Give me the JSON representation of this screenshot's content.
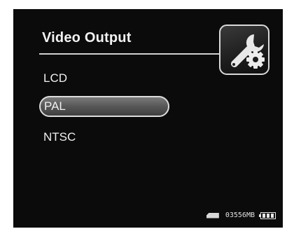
{
  "screen": {
    "title": "Video Output"
  },
  "menu": {
    "items": [
      {
        "label": "LCD",
        "selected": false
      },
      {
        "label": "PAL",
        "selected": true
      },
      {
        "label": "NTSC",
        "selected": false
      }
    ]
  },
  "status_bar": {
    "storage_text": "03556MB",
    "storage_icon": "sd-card-icon",
    "battery_icon": "battery-icon",
    "battery_level": 1.0
  },
  "icons": {
    "settings": "wrench-gear-icon"
  },
  "colors": {
    "background": "#0b0b0b",
    "text": "#f0f0f0",
    "selection_fill": "#5a5a5a",
    "selection_border": "#dcdcdc"
  }
}
